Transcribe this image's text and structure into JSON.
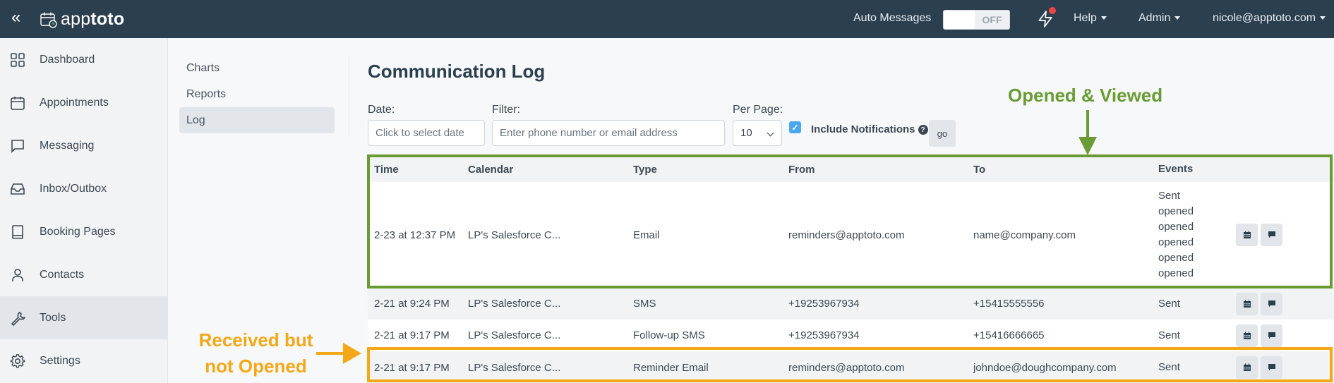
{
  "topbar": {
    "collapse_icon": "chevrons-left-icon",
    "logo": {
      "light": "app",
      "bold": "toto",
      "icon": "calendar-clock-icon"
    },
    "auto_messages_label": "Auto Messages",
    "auto_messages_toggle": "OFF",
    "notifications_icon": "lightning-bolt-icon",
    "help_label": "Help",
    "admin_label": "Admin",
    "user_label": "nicole@apptoto.com"
  },
  "sidebar": {
    "items": [
      {
        "label": "Dashboard",
        "icon": "grid-icon"
      },
      {
        "label": "Appointments",
        "icon": "calendar-icon"
      },
      {
        "label": "Messaging",
        "icon": "message-square-icon"
      },
      {
        "label": "Inbox/Outbox",
        "icon": "inbox-icon"
      },
      {
        "label": "Booking Pages",
        "icon": "book-icon"
      },
      {
        "label": "Contacts",
        "icon": "user-icon"
      },
      {
        "label": "Tools",
        "icon": "wrench-icon",
        "active": true
      },
      {
        "label": "Settings",
        "icon": "gear-icon"
      }
    ]
  },
  "subnav": {
    "items": [
      {
        "label": "Charts"
      },
      {
        "label": "Reports"
      },
      {
        "label": "Log",
        "active": true
      }
    ]
  },
  "main": {
    "title": "Communication Log",
    "filters": {
      "date_label": "Date:",
      "date_placeholder": "Click to select date",
      "filter_label": "Filter:",
      "filter_placeholder": "Enter phone number or email address",
      "per_page_label": "Per Page:",
      "per_page_value": "10",
      "include_notifications_label": "Include Notifications",
      "include_notifications_checked": true,
      "go_label": "go"
    },
    "table": {
      "columns": [
        "Time",
        "Calendar",
        "Type",
        "From",
        "To",
        "Events"
      ],
      "rows": [
        {
          "time": "2-23 at 12:37 PM",
          "calendar": "LP's Salesforce C...",
          "type": "Email",
          "from": "reminders@apptoto.com",
          "to": "name@company.com",
          "events": [
            "Sent",
            "opened",
            "opened",
            "opened",
            "opened",
            "opened"
          ]
        },
        {
          "time": "2-21 at 9:24 PM",
          "calendar": "LP's Salesforce C...",
          "type": "SMS",
          "from": "+19253967934",
          "to": "+15415555556",
          "events": [
            "Sent"
          ]
        },
        {
          "time": "2-21 at 9:17 PM",
          "calendar": "LP's Salesforce C...",
          "type": "Follow-up SMS",
          "from": "+19253967934",
          "to": "+15416666665",
          "events": [
            "Sent"
          ]
        },
        {
          "time": "2-21 at 9:17 PM",
          "calendar": "LP's Salesforce C...",
          "type": "Reminder Email",
          "from": "reminders@apptoto.com",
          "to": "johndoe@doughcompany.com",
          "events": [
            "Sent"
          ]
        }
      ],
      "row_actions": [
        "calendar-icon",
        "comment-icon"
      ]
    }
  },
  "annotations": {
    "opened": {
      "text": "Opened & Viewed",
      "color": "#6a9b34"
    },
    "not_opened": {
      "line1": "Received but",
      "line2": "not Opened",
      "color": "#f4a817"
    }
  },
  "colors": {
    "topbar": "#2c3f4f",
    "checkbox": "#4aa8f0",
    "notification_dot": "#ef4444"
  }
}
